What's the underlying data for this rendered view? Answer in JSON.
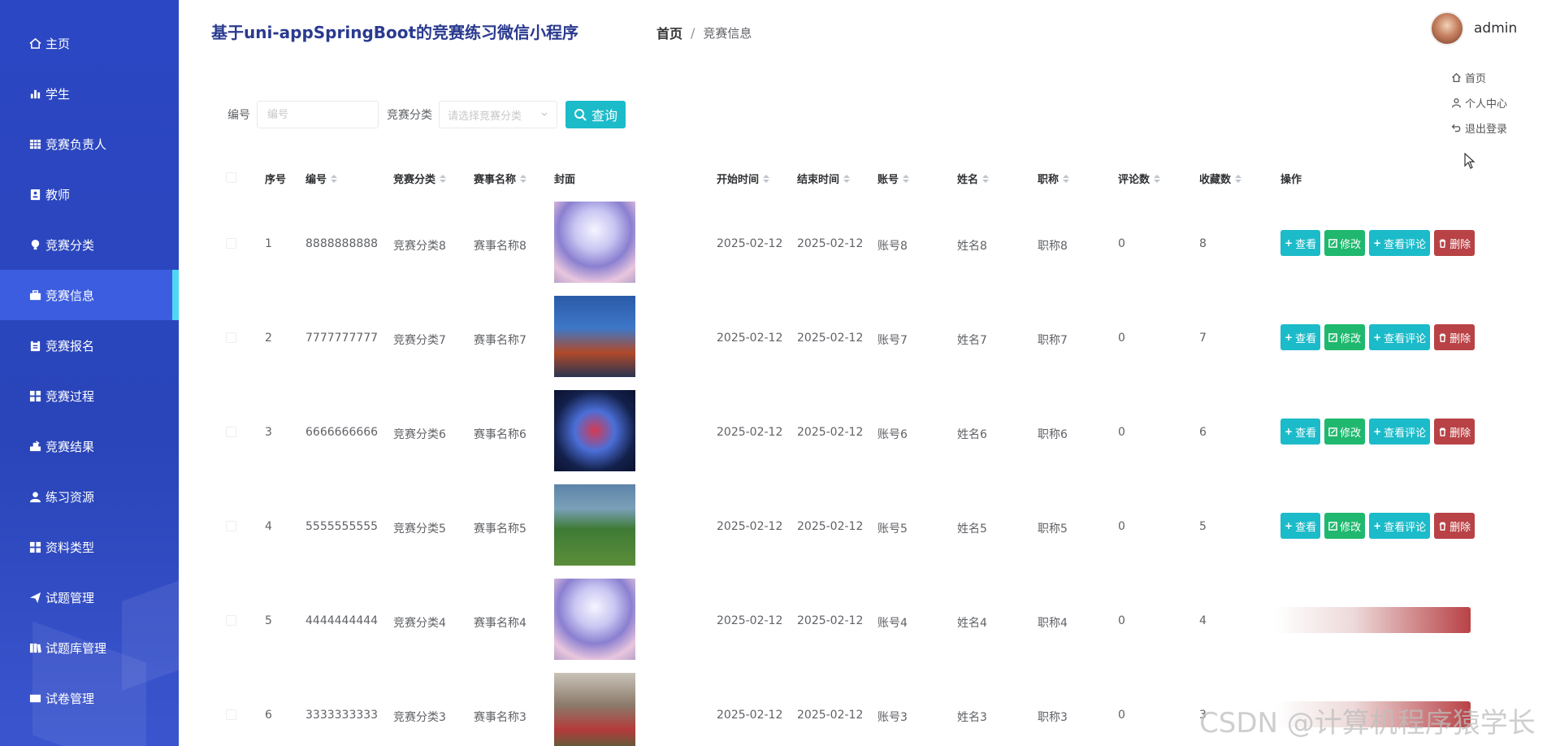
{
  "sidebar": {
    "items": [
      {
        "label": "主页",
        "icon": "home-icon"
      },
      {
        "label": "学生",
        "icon": "bar-chart-icon"
      },
      {
        "label": "竞赛负责人",
        "icon": "grid-icon"
      },
      {
        "label": "教师",
        "icon": "id-card-icon"
      },
      {
        "label": "竞赛分类",
        "icon": "bulb-icon"
      },
      {
        "label": "竞赛信息",
        "icon": "briefcase-icon",
        "active": true
      },
      {
        "label": "竞赛报名",
        "icon": "clipboard-icon"
      },
      {
        "label": "竞赛过程",
        "icon": "apps-icon"
      },
      {
        "label": "竞赛结果",
        "icon": "trophy-icon"
      },
      {
        "label": "练习资源",
        "icon": "user-icon"
      },
      {
        "label": "资料类型",
        "icon": "apps-icon"
      },
      {
        "label": "试题管理",
        "icon": "send-icon"
      },
      {
        "label": "试题库管理",
        "icon": "library-icon"
      },
      {
        "label": "试卷管理",
        "icon": "paper-icon"
      }
    ]
  },
  "header": {
    "brand": "基于uni-appSpringBoot的竞赛练习微信小程序",
    "breadcrumb": {
      "home": "首页",
      "separator": "/",
      "current": "竞赛信息"
    }
  },
  "user": {
    "name": "admin",
    "menu": [
      {
        "label": "首页",
        "icon": "home-icon"
      },
      {
        "label": "个人中心",
        "icon": "user-icon"
      },
      {
        "label": "退出登录",
        "icon": "logout-icon"
      }
    ]
  },
  "search": {
    "number_label": "编号",
    "number_placeholder": "编号",
    "category_label": "竞赛分类",
    "category_placeholder": "请选择竞赛分类",
    "query_button": "查询"
  },
  "table": {
    "columns": [
      "序号",
      "编号",
      "竞赛分类",
      "赛事名称",
      "封面",
      "开始时间",
      "结束时间",
      "账号",
      "姓名",
      "职称",
      "评论数",
      "收藏数",
      "操作"
    ],
    "actions": {
      "view": "查看",
      "edit": "修改",
      "comment": "查看评论",
      "delete": "删除"
    },
    "rows": [
      {
        "idx": "1",
        "number": "8888888888",
        "category": "竞赛分类8",
        "name": "赛事名称8",
        "start": "2025-02-12",
        "end": "2025-02-12",
        "account": "账号8",
        "person": "姓名8",
        "title": "职称8",
        "comments": "0",
        "favorites": "8"
      },
      {
        "idx": "2",
        "number": "7777777777",
        "category": "竞赛分类7",
        "name": "赛事名称7",
        "start": "2025-02-12",
        "end": "2025-02-12",
        "account": "账号7",
        "person": "姓名7",
        "title": "职称7",
        "comments": "0",
        "favorites": "7"
      },
      {
        "idx": "3",
        "number": "6666666666",
        "category": "竞赛分类6",
        "name": "赛事名称6",
        "start": "2025-02-12",
        "end": "2025-02-12",
        "account": "账号6",
        "person": "姓名6",
        "title": "职称6",
        "comments": "0",
        "favorites": "6"
      },
      {
        "idx": "4",
        "number": "5555555555",
        "category": "竞赛分类5",
        "name": "赛事名称5",
        "start": "2025-02-12",
        "end": "2025-02-12",
        "account": "账号5",
        "person": "姓名5",
        "title": "职称5",
        "comments": "0",
        "favorites": "5"
      },
      {
        "idx": "5",
        "number": "4444444444",
        "category": "竞赛分类4",
        "name": "赛事名称4",
        "start": "2025-02-12",
        "end": "2025-02-12",
        "account": "账号4",
        "person": "姓名4",
        "title": "职称4",
        "comments": "0",
        "favorites": "4"
      },
      {
        "idx": "6",
        "number": "3333333333",
        "category": "竞赛分类3",
        "name": "赛事名称3",
        "start": "2025-02-12",
        "end": "2025-02-12",
        "account": "账号3",
        "person": "姓名3",
        "title": "职称3",
        "comments": "0",
        "favorites": "3"
      }
    ]
  },
  "watermark": "CSDN @计算机程序猿学长",
  "colors": {
    "sidebar": "#2c47c4",
    "active": "#3d5de0",
    "accent": "#1cbbc9",
    "edit": "#1fb86e",
    "delete": "#b84246",
    "brand_text": "#2a3a8f"
  }
}
